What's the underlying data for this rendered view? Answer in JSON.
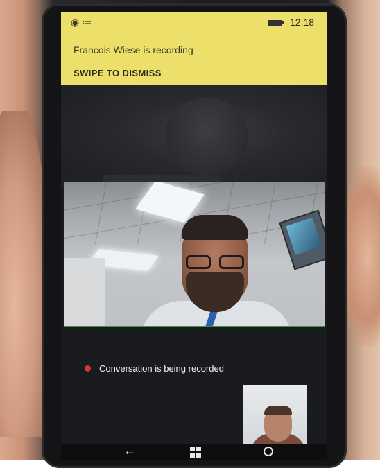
{
  "status_bar": {
    "time": "12:18",
    "icons": [
      "app-icon",
      "wifi-icon",
      "battery-icon"
    ]
  },
  "notification": {
    "message": "Francois Wiese is recording",
    "action": "SWIPE TO DISMISS",
    "background_color": "#ede06a"
  },
  "call": {
    "recording_status": "Conversation is being recorded",
    "recording_dot_color": "#d8343b"
  },
  "nav_bar": {
    "icons": [
      "back-arrow-icon",
      "windows-start-icon",
      "search-icon"
    ],
    "back_glyph": "←"
  }
}
